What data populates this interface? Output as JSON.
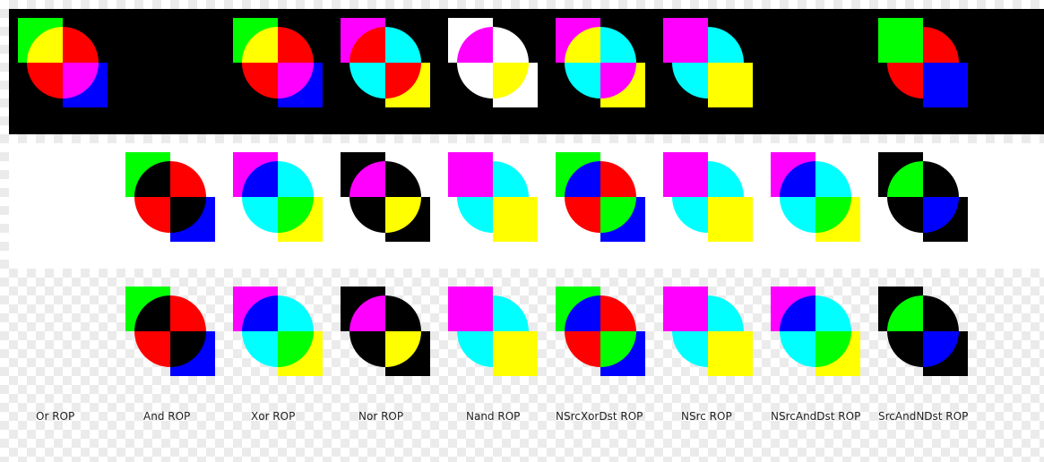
{
  "colors": {
    "black": "#000000",
    "white": "#ffffff",
    "red": "#ff0000",
    "green": "#00ff00",
    "blue": "#0000ff",
    "yellow": "#ffff00",
    "magenta": "#ff00ff",
    "cyan": "#00ffff"
  },
  "labels": [
    "Or ROP",
    "And ROP",
    "Xor ROP",
    "Nor ROP",
    "Nand ROP",
    "NSrcXorDst ROP",
    "NSrc ROP",
    "NSrcAndDst ROP",
    "SrcAndNDst ROP"
  ],
  "rows": [
    {
      "name": "black-background",
      "cells": [
        {
          "sq1": "green",
          "q": [
            "yellow",
            "red",
            "red",
            "magenta"
          ],
          "sq2": "blue"
        },
        null,
        {
          "sq1": "green",
          "q": [
            "yellow",
            "red",
            "red",
            "magenta"
          ],
          "sq2": "blue"
        },
        {
          "sq1": "magenta",
          "q": [
            "red",
            "cyan",
            "cyan",
            "red"
          ],
          "sq2": "yellow"
        },
        {
          "sq1": "white",
          "q": [
            "magenta",
            "white",
            "white",
            "yellow"
          ],
          "sq2": "white"
        },
        {
          "sq1": "magenta",
          "q": [
            "yellow",
            "cyan",
            "cyan",
            "magenta"
          ],
          "sq2": "yellow"
        },
        {
          "sq1": "magenta",
          "q": [
            "magenta",
            "cyan",
            "cyan",
            "yellow"
          ],
          "sq2": "yellow"
        },
        null,
        {
          "sq1": "green",
          "q": [
            "green",
            "red",
            "red",
            "blue"
          ],
          "sq2": "blue"
        }
      ]
    },
    {
      "name": "white-background",
      "cells": [
        null,
        {
          "sq1": "green",
          "q": [
            "black",
            "red",
            "red",
            "black"
          ],
          "sq2": "blue"
        },
        {
          "sq1": "magenta",
          "q": [
            "blue",
            "cyan",
            "cyan",
            "green"
          ],
          "sq2": "yellow"
        },
        {
          "sq1": "black",
          "q": [
            "magenta",
            "black",
            "black",
            "yellow"
          ],
          "sq2": "black"
        },
        {
          "sq1": "magenta",
          "q": [
            "magenta",
            "cyan",
            "cyan",
            "yellow"
          ],
          "sq2": "yellow"
        },
        {
          "sq1": "green",
          "q": [
            "blue",
            "red",
            "red",
            "green"
          ],
          "sq2": "blue"
        },
        {
          "sq1": "magenta",
          "q": [
            "magenta",
            "cyan",
            "cyan",
            "yellow"
          ],
          "sq2": "yellow"
        },
        {
          "sq1": "magenta",
          "q": [
            "blue",
            "cyan",
            "cyan",
            "green"
          ],
          "sq2": "yellow"
        },
        {
          "sq1": "black",
          "q": [
            "green",
            "black",
            "black",
            "blue"
          ],
          "sq2": "black"
        }
      ]
    },
    {
      "name": "transparent-background",
      "cells": [
        null,
        {
          "sq1": "green",
          "q": [
            "black",
            "red",
            "red",
            "black"
          ],
          "sq2": "blue"
        },
        {
          "sq1": "magenta",
          "q": [
            "blue",
            "cyan",
            "cyan",
            "green"
          ],
          "sq2": "yellow"
        },
        {
          "sq1": "black",
          "q": [
            "magenta",
            "black",
            "black",
            "yellow"
          ],
          "sq2": "black"
        },
        {
          "sq1": "magenta",
          "q": [
            "magenta",
            "cyan",
            "cyan",
            "yellow"
          ],
          "sq2": "yellow"
        },
        {
          "sq1": "green",
          "q": [
            "blue",
            "red",
            "red",
            "green"
          ],
          "sq2": "blue"
        },
        {
          "sq1": "magenta",
          "q": [
            "magenta",
            "cyan",
            "cyan",
            "yellow"
          ],
          "sq2": "yellow"
        },
        {
          "sq1": "magenta",
          "q": [
            "blue",
            "cyan",
            "cyan",
            "green"
          ],
          "sq2": "yellow"
        },
        {
          "sq1": "black",
          "q": [
            "green",
            "black",
            "black",
            "blue"
          ],
          "sq2": "black"
        }
      ]
    }
  ]
}
